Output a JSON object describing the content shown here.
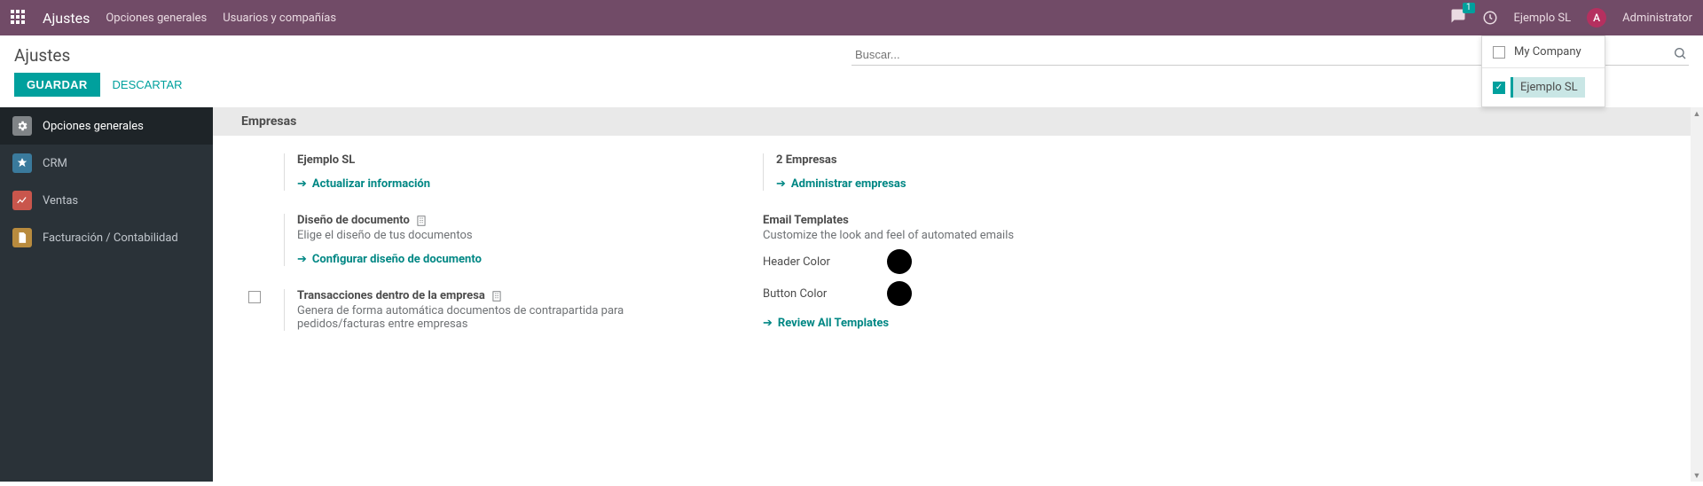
{
  "navbar": {
    "app_title": "Ajustes",
    "menu": [
      "Opciones generales",
      "Usuarios y compañías"
    ],
    "messages_count": "1",
    "company": "Ejemplo SL",
    "avatar_initial": "A",
    "user": "Administrator"
  },
  "control": {
    "page_title": "Ajustes",
    "search_placeholder": "Buscar...",
    "save": "GUARDAR",
    "discard": "DESCARTAR"
  },
  "sidebar": {
    "items": [
      {
        "label": "Opciones generales"
      },
      {
        "label": "CRM"
      },
      {
        "label": "Ventas"
      },
      {
        "label": "Facturación / Contabilidad"
      }
    ]
  },
  "section": {
    "header": "Empresas",
    "left": {
      "company_name": "Ejemplo SL",
      "update_info": "Actualizar información",
      "doc_design_title": "Diseño de documento",
      "doc_design_desc": "Elige el diseño de tus documentos",
      "doc_design_action": "Configurar diseño de documento",
      "intercompany_title": "Transacciones dentro de la empresa",
      "intercompany_desc": "Genera de forma automática documentos de contrapartida para pedidos/facturas entre empresas"
    },
    "right": {
      "companies_count": "2 Empresas",
      "manage_companies": "Administrar empresas",
      "email_templates_title": "Email Templates",
      "email_templates_desc": "Customize the look and feel of automated emails",
      "header_color_label": "Header Color",
      "button_color_label": "Button Color",
      "header_color": "#000000",
      "button_color": "#000000",
      "review_templates": "Review All Templates"
    }
  },
  "company_dropdown": {
    "items": [
      {
        "name": "My Company",
        "checked": false
      },
      {
        "name": "Ejemplo SL",
        "checked": true
      }
    ]
  }
}
